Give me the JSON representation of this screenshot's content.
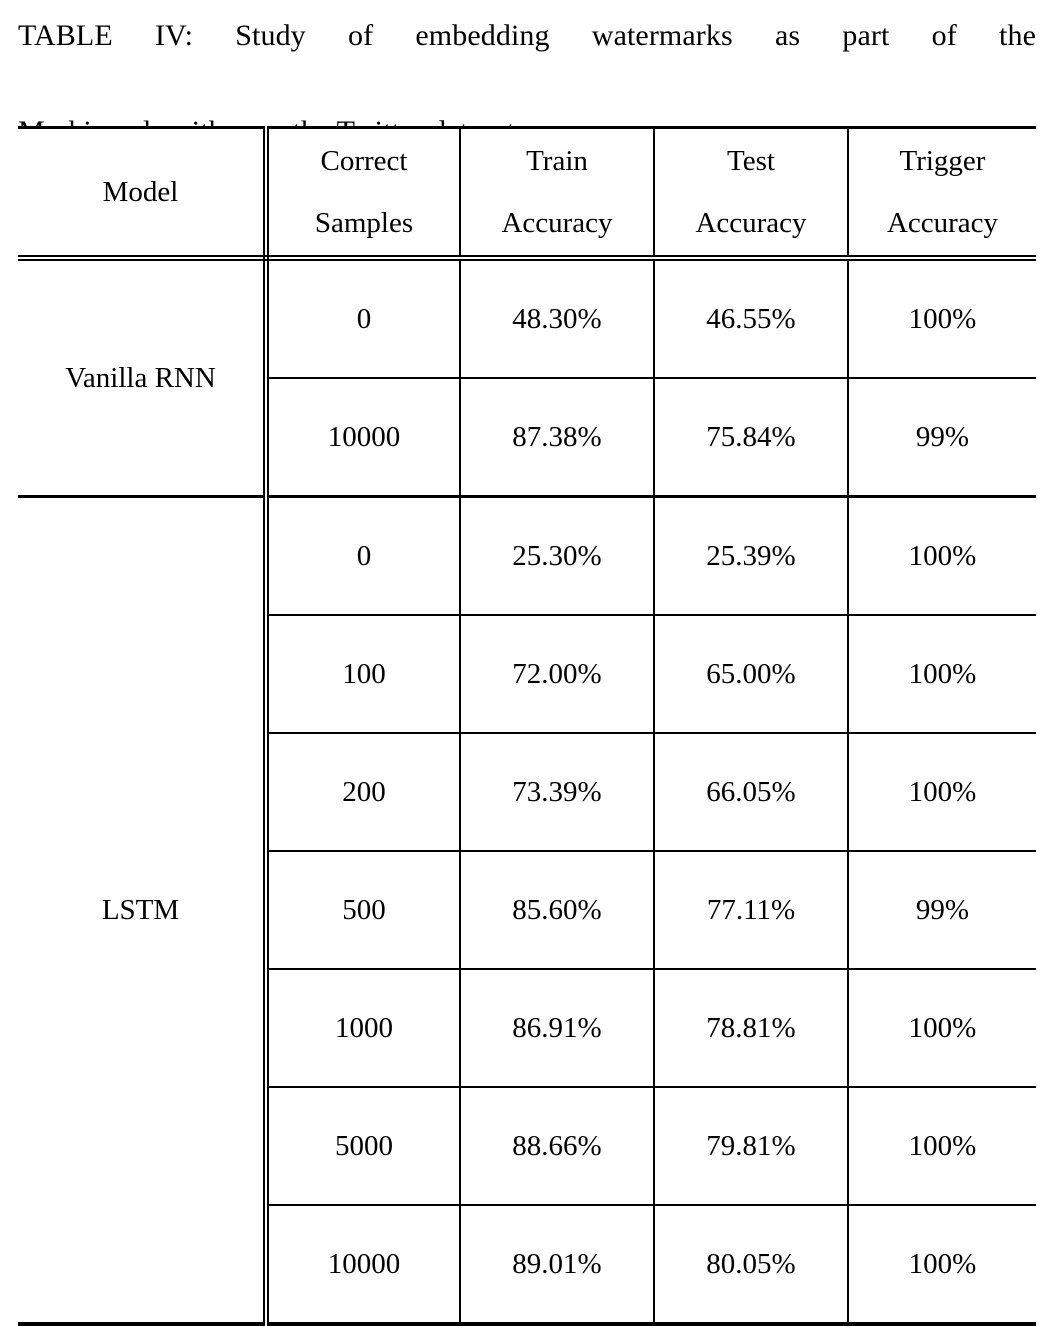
{
  "caption": {
    "label": "TABLE IV:",
    "line1": "TABLE IV: Study of embedding watermarks as part of the",
    "line2": "Marking algorithm on the Twitter dataset.",
    "full_text": "TABLE IV: Study of embedding watermarks as part of the Marking algorithm on the Twitter dataset."
  },
  "table": {
    "columns": [
      {
        "key": "model",
        "line1": "Model",
        "line2": ""
      },
      {
        "key": "samples",
        "line1": "Correct",
        "line2": "Samples"
      },
      {
        "key": "train",
        "line1": "Train",
        "line2": "Accuracy"
      },
      {
        "key": "test",
        "line1": "Test",
        "line2": "Accuracy"
      },
      {
        "key": "trigger",
        "line1": "Trigger",
        "line2": "Accuracy"
      }
    ],
    "groups": [
      {
        "model": "Vanilla RNN",
        "rows": [
          {
            "samples": "0",
            "train": "48.30%",
            "test": "46.55%",
            "trigger": "100%"
          },
          {
            "samples": "10000",
            "train": "87.38%",
            "test": "75.84%",
            "trigger": "99%"
          }
        ]
      },
      {
        "model": "LSTM",
        "rows": [
          {
            "samples": "0",
            "train": "25.30%",
            "test": "25.39%",
            "trigger": "100%"
          },
          {
            "samples": "100",
            "train": "72.00%",
            "test": "65.00%",
            "trigger": "100%"
          },
          {
            "samples": "200",
            "train": "73.39%",
            "test": "66.05%",
            "trigger": "100%"
          },
          {
            "samples": "500",
            "train": "85.60%",
            "test": "77.11%",
            "trigger": "99%"
          },
          {
            "samples": "1000",
            "train": "86.91%",
            "test": "78.81%",
            "trigger": "100%"
          },
          {
            "samples": "5000",
            "train": "88.66%",
            "test": "79.81%",
            "trigger": "100%"
          },
          {
            "samples": "10000",
            "train": "89.01%",
            "test": "80.05%",
            "trigger": "100%"
          }
        ]
      }
    ]
  },
  "colors": {
    "text": "#000000",
    "rule": "#000000",
    "background": "#ffffff"
  }
}
